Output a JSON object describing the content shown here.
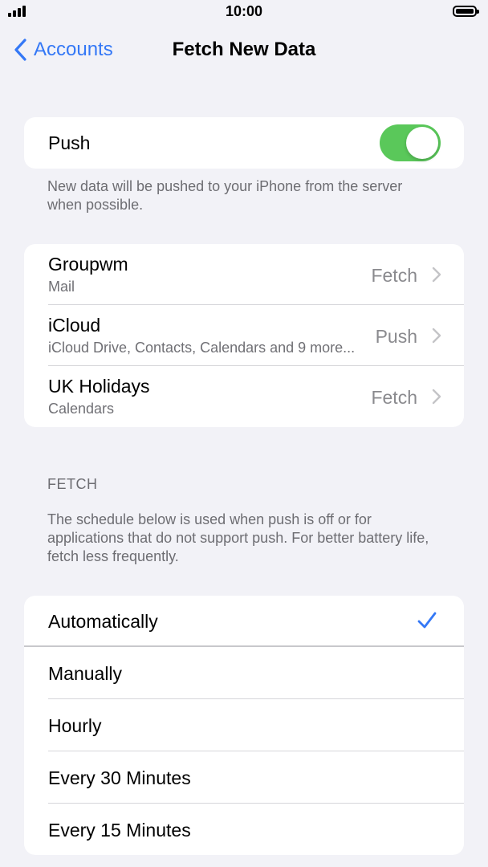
{
  "status_bar": {
    "time": "10:00"
  },
  "nav": {
    "back_label": "Accounts",
    "title": "Fetch New Data"
  },
  "push": {
    "label": "Push",
    "enabled": true,
    "footnote": "New data will be pushed to your iPhone from the server when possible."
  },
  "accounts": [
    {
      "name": "Groupwm",
      "detail": "Mail",
      "mode": "Fetch"
    },
    {
      "name": "iCloud",
      "detail": "iCloud Drive, Contacts, Calendars and 9 more...",
      "mode": "Push"
    },
    {
      "name": "UK Holidays",
      "detail": "Calendars",
      "mode": "Fetch"
    }
  ],
  "fetch": {
    "header": "FETCH",
    "footnote": "The schedule below is used when push is off or for applications that do not support push. For better battery life, fetch less frequently.",
    "options": [
      "Automatically",
      "Manually",
      "Hourly",
      "Every 30 Minutes",
      "Every 15 Minutes"
    ],
    "selected": "Automatically"
  },
  "colors": {
    "accent": "#3478f6",
    "toggle_on": "#5ac85a",
    "background": "#f2f2f7"
  },
  "icons": {
    "back": "chevron-left-icon",
    "disclosure": "chevron-right-icon",
    "selected": "checkmark-icon"
  }
}
